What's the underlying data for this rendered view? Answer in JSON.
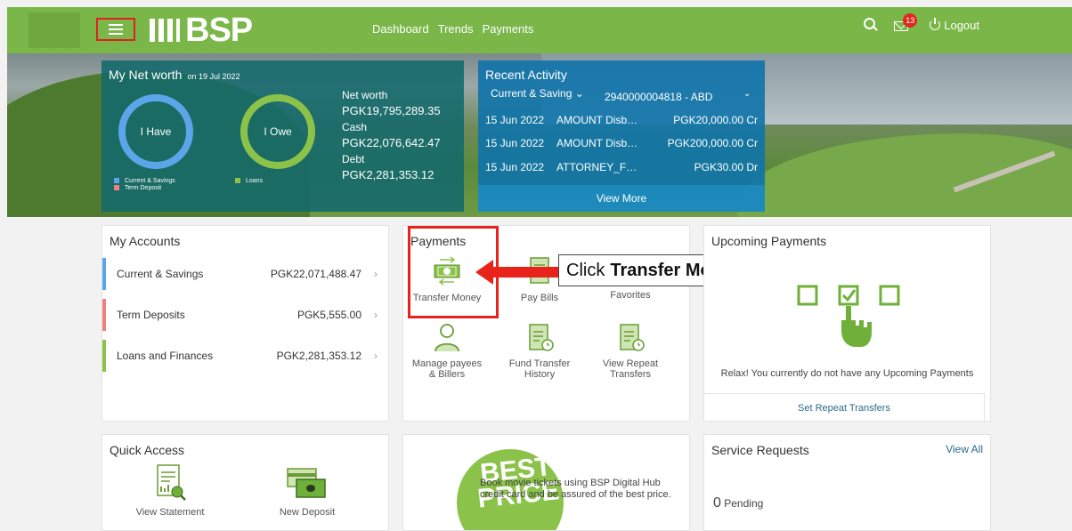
{
  "header": {
    "logo": "BSP",
    "nav": [
      "Dashboard",
      "Trends",
      "Payments"
    ],
    "mail_badge": "13",
    "logout": "Logout"
  },
  "networth": {
    "title": "My Net worth",
    "date": "on 19 Jul 2022",
    "have_label": "I Have",
    "owe_label": "I Owe",
    "legend_have": [
      "Current & Savings",
      "Term Deposit"
    ],
    "legend_owe": "Loans",
    "net_label": "Net worth",
    "net_value": "PGK19,795,289.35",
    "cash_label": "Cash",
    "cash_value": "PGK22,076,642.47",
    "debt_label": "Debt",
    "debt_value": "PGK2,281,353.12",
    "colors": {
      "have": "#5aa6e8",
      "owe": "#8bc34a",
      "term": "#f08080"
    }
  },
  "recent": {
    "title": "Recent Activity",
    "selector": "Current & Saving",
    "account": "2940000004818 - ABD",
    "rows": [
      {
        "date": "15 Jun 2022",
        "text": "AMOUNT Disb…",
        "amount": "PGK20,000.00 Cr"
      },
      {
        "date": "15 Jun 2022",
        "text": "AMOUNT Disb…",
        "amount": "PGK200,000.00 Cr"
      },
      {
        "date": "15 Jun 2022",
        "text": "ATTORNEY_F…",
        "amount": "PGK30.00 Dr"
      }
    ],
    "view_more": "View More"
  },
  "accounts": {
    "title": "My Accounts",
    "items": [
      {
        "name": "Current & Savings",
        "amount": "PGK22,071,488.47",
        "color": "#5aa6e8"
      },
      {
        "name": "Term Deposits",
        "amount": "PGK5,555.00",
        "color": "#f08080"
      },
      {
        "name": "Loans and Finances",
        "amount": "PGK2,281,353.12",
        "color": "#8bc34a"
      }
    ]
  },
  "payments": {
    "title": "Payments",
    "items": [
      "Transfer Money",
      "Pay Bills",
      "Favorites",
      "Manage payees & Billers",
      "Fund Transfer History",
      "View Repeat Transfers"
    ]
  },
  "callout": {
    "prefix": "Click",
    "bold": "Transfer Money"
  },
  "upcoming": {
    "title": "Upcoming Payments",
    "message": "Relax! You currently do not have any Upcoming Payments",
    "link": "Set Repeat Transfers"
  },
  "quick": {
    "title": "Quick Access",
    "items": [
      "View Statement",
      "New Deposit"
    ]
  },
  "promo": {
    "badge_line1": "BEST",
    "badge_line2": "PRICE",
    "text": "Book movie tickets using BSP Digital Hub credit card and be assured of the best price."
  },
  "service": {
    "title": "Service Requests",
    "view_all": "View All",
    "count": "0",
    "pending": "Pending"
  }
}
